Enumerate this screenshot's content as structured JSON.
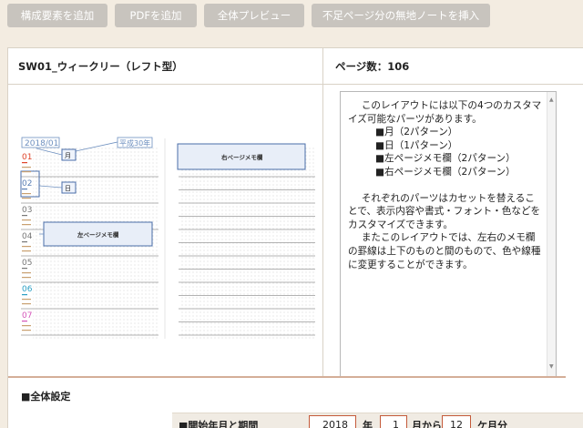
{
  "toolbar": {
    "buttons": [
      "構成要素を追加",
      "PDFを追加",
      "全体プレビュー",
      "不足ページ分の無地ノートを挿入"
    ]
  },
  "template": {
    "name": "SW01_ウィークリー（レフト型）",
    "page_count": "ページ数：106"
  },
  "preview": {
    "year_month": "2018/01",
    "era": "平成30年",
    "label_month": "月",
    "label_day": "日",
    "label_left_memo": "左ページメモ欄",
    "label_right_memo": "右ページメモ欄",
    "days": [
      "01",
      "02",
      "03",
      "04",
      "05",
      "06",
      "07"
    ],
    "day_colors": [
      "#e0442a",
      "#5a7fb5",
      "#777777",
      "#777777",
      "#777777",
      "#2a9fc4",
      "#d455b8"
    ]
  },
  "description": {
    "intro": "このレイアウトには以下の4つのカスタマイズ可能なパーツがあります。",
    "items": [
      "■月（2パターン）",
      "■日（1パターン）",
      "■左ページメモ欄（2パターン）",
      "■右ページメモ欄（2パターン）"
    ],
    "para2": "それぞれのパーツはカセットを替えることで、表示内容や書式・フォント・色などをカスタマイズできます。",
    "para3": "またこのレイアウトでは、左右のメモ欄の罫線は上下のものと間のもので、色や線種に変更することができます。"
  },
  "settings": {
    "section_title": "■全体設定",
    "start_label": "■開始年月と期間",
    "year_value": "2018",
    "year_unit": "年",
    "month_value": "1",
    "month_unit": "月から",
    "months_value": "12",
    "months_unit": "ケ月分"
  }
}
